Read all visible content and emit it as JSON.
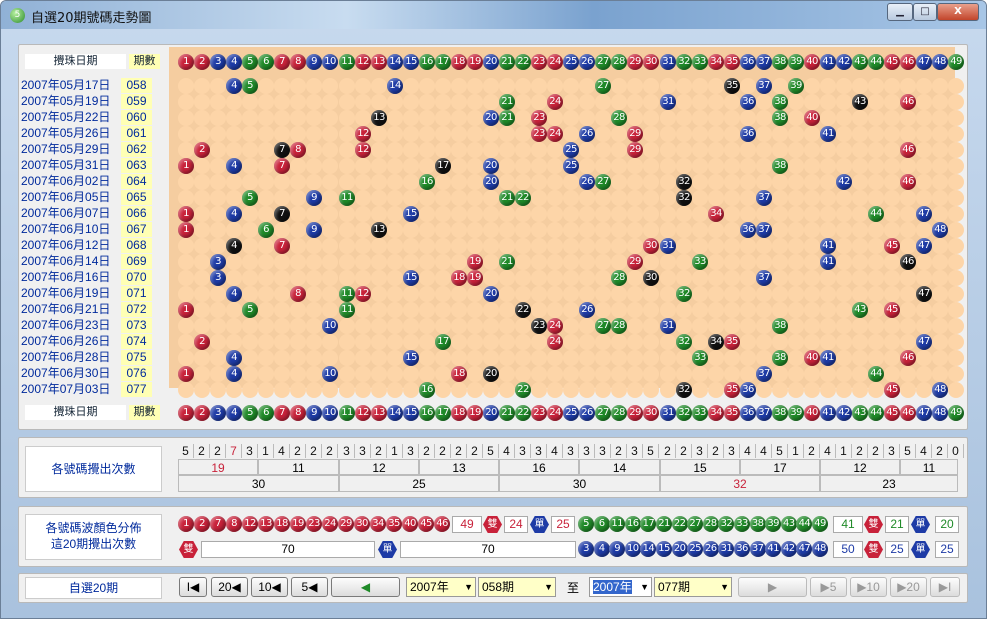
{
  "window": {
    "title": "自選20期號碼走勢圖",
    "buttons": [
      "▁",
      "□",
      "X"
    ]
  },
  "table": {
    "date_header": "攪珠日期",
    "period_header": "期數",
    "draws": [
      {
        "date": "2007年05月17日",
        "period": "058",
        "numbers": [
          4,
          5,
          14,
          27,
          35,
          37,
          39
        ]
      },
      {
        "date": "2007年05月19日",
        "period": "059",
        "numbers": [
          21,
          24,
          31,
          36,
          38,
          43,
          46
        ]
      },
      {
        "date": "2007年05月22日",
        "period": "060",
        "numbers": [
          13,
          20,
          21,
          23,
          28,
          38,
          40
        ]
      },
      {
        "date": "2007年05月26日",
        "period": "061",
        "numbers": [
          12,
          23,
          24,
          26,
          29,
          36,
          41
        ]
      },
      {
        "date": "2007年05月29日",
        "period": "062",
        "numbers": [
          2,
          7,
          8,
          12,
          25,
          29,
          46
        ]
      },
      {
        "date": "2007年05月31日",
        "period": "063",
        "numbers": [
          1,
          4,
          7,
          17,
          20,
          25,
          38
        ]
      },
      {
        "date": "2007年06月02日",
        "period": "064",
        "numbers": [
          16,
          20,
          26,
          27,
          32,
          42,
          46
        ]
      },
      {
        "date": "2007年06月05日",
        "period": "065",
        "numbers": [
          5,
          9,
          11,
          21,
          22,
          32,
          37
        ]
      },
      {
        "date": "2007年06月07日",
        "period": "066",
        "numbers": [
          1,
          4,
          7,
          15,
          34,
          44,
          47
        ]
      },
      {
        "date": "2007年06月10日",
        "period": "067",
        "numbers": [
          1,
          6,
          9,
          13,
          36,
          37,
          48
        ]
      },
      {
        "date": "2007年06月12日",
        "period": "068",
        "numbers": [
          4,
          7,
          30,
          31,
          41,
          45,
          47
        ]
      },
      {
        "date": "2007年06月14日",
        "period": "069",
        "numbers": [
          3,
          19,
          21,
          29,
          33,
          41,
          46
        ]
      },
      {
        "date": "2007年06月16日",
        "period": "070",
        "numbers": [
          3,
          15,
          18,
          19,
          28,
          30,
          37
        ]
      },
      {
        "date": "2007年06月19日",
        "period": "071",
        "numbers": [
          4,
          8,
          11,
          12,
          20,
          32,
          47
        ]
      },
      {
        "date": "2007年06月21日",
        "period": "072",
        "numbers": [
          1,
          5,
          11,
          22,
          26,
          43,
          45
        ]
      },
      {
        "date": "2007年06月23日",
        "period": "073",
        "numbers": [
          10,
          23,
          24,
          27,
          28,
          31,
          38
        ]
      },
      {
        "date": "2007年06月26日",
        "period": "074",
        "numbers": [
          2,
          17,
          24,
          32,
          34,
          35,
          47
        ]
      },
      {
        "date": "2007年06月28日",
        "period": "075",
        "numbers": [
          4,
          15,
          33,
          38,
          40,
          41,
          46
        ]
      },
      {
        "date": "2007年06月30日",
        "period": "076",
        "numbers": [
          1,
          4,
          10,
          18,
          20,
          37,
          44
        ]
      },
      {
        "date": "2007年07月03日",
        "period": "077",
        "numbers": [
          16,
          22,
          32,
          35,
          36,
          45,
          48
        ]
      }
    ],
    "dark_balls": [
      [
        0,
        35
      ],
      [
        1,
        43
      ],
      [
        2,
        13
      ],
      [
        4,
        7
      ],
      [
        5,
        17
      ],
      [
        6,
        32
      ],
      [
        7,
        32
      ],
      [
        8,
        7
      ],
      [
        9,
        13
      ],
      [
        10,
        4
      ],
      [
        11,
        46
      ],
      [
        12,
        30
      ],
      [
        13,
        47
      ],
      [
        14,
        22
      ],
      [
        15,
        23
      ],
      [
        16,
        33
      ],
      [
        16,
        34
      ],
      [
        18,
        20
      ],
      [
        19,
        32
      ]
    ]
  },
  "header_numbers": [
    "1",
    "2",
    "3",
    "4",
    "5",
    "6",
    "7",
    "8",
    "9",
    "10",
    "11",
    "12",
    "13",
    "14",
    "15",
    "16",
    "17",
    "18",
    "19",
    "20",
    "21",
    "22",
    "23",
    "24",
    "25",
    "26",
    "27",
    "28",
    "29",
    "30",
    "31",
    "32",
    "33",
    "34",
    "35",
    "36",
    "37",
    "38",
    "39",
    "40",
    "41",
    "42",
    "43",
    "44",
    "45",
    "46",
    "47",
    "48",
    "49"
  ],
  "ball_colors": {
    "red": "#c8223a",
    "blue": "#1e3ba6",
    "green": "#1f8a28",
    "dark": "#111111"
  },
  "frequency": {
    "label": "各號碼攪出次數",
    "counts": [
      "5",
      "2",
      "2",
      "7",
      "3",
      "1",
      "4",
      "2",
      "2",
      "2",
      "3",
      "3",
      "2",
      "1",
      "3",
      "2",
      "2",
      "2",
      "2",
      "5",
      "4",
      "3",
      "3",
      "4",
      "3",
      "3",
      "3",
      "2",
      "3",
      "5",
      "2",
      "2",
      "3",
      "2",
      "3",
      "4",
      "4",
      "5",
      "1",
      "2",
      "4",
      "1",
      "2",
      "2",
      "3",
      "5",
      "4",
      "2",
      "0"
    ],
    "groups_of_5": [
      "19",
      "11",
      "12",
      "13",
      "16",
      "14",
      "15",
      "17",
      "12",
      "11"
    ],
    "groups_of_10": [
      "30",
      "25",
      "30",
      "32",
      "23"
    ]
  },
  "color_dist": {
    "label_line1": "各號碼波顏色分佈",
    "label_line2": "這20期攪出次數",
    "red_total": "49",
    "red_even": "24",
    "red_odd": "25",
    "green_total": "41",
    "green_even": "21",
    "green_odd": "20",
    "blue_total": "50",
    "blue_even": "25",
    "blue_odd": "25",
    "all_even": "70",
    "all_odd": "70",
    "even_label": "雙",
    "odd_label": "單"
  },
  "nav": {
    "label": "自選20期",
    "btn_first": "I◀",
    "btn_20": "20◀",
    "btn_10": "10◀",
    "btn_5": "5◀",
    "btn_1": "◀",
    "from_year": "2007年",
    "from_period": "058期",
    "to_label": "至",
    "to_year": "2007年",
    "to_period": "077期",
    "fwd_1": "▶",
    "fwd_5": "▶5",
    "fwd_10": "▶10",
    "fwd_20": "▶20",
    "fwd_last": "▶I"
  }
}
